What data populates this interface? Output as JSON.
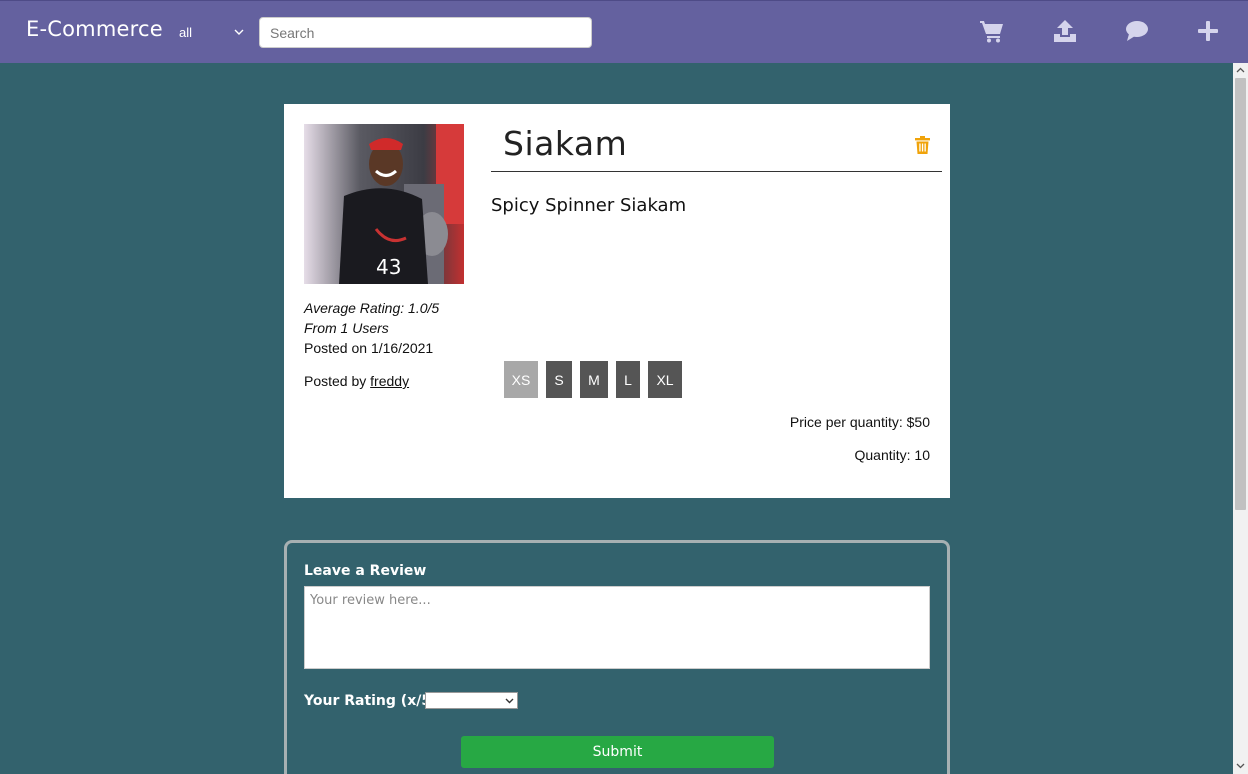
{
  "header": {
    "brand": "E-Commerce",
    "category_selected": "all",
    "search_placeholder": "Search",
    "icons": [
      "cart-icon",
      "upload-icon",
      "chat-icon",
      "plus-icon"
    ]
  },
  "product": {
    "title": "Siakam",
    "description": "Spicy Spinner Siakam",
    "average_rating": "Average Rating: 1.0/5",
    "rating_users": "From 1 Users",
    "posted_on": "Posted on 1/16/2021",
    "posted_by_prefix": "Posted by ",
    "posted_by_user": "freddy",
    "sizes": [
      {
        "label": "XS",
        "available": false
      },
      {
        "label": "S",
        "available": true
      },
      {
        "label": "M",
        "available": true
      },
      {
        "label": "L",
        "available": true
      },
      {
        "label": "XL",
        "available": true
      }
    ],
    "price": "Price per quantity: $50",
    "quantity": "Quantity: 10",
    "jersey_text": "43"
  },
  "review": {
    "title": "Leave a Review",
    "placeholder": "Your review here...",
    "rating_label": "Your Rating (x/5):",
    "rating_value": "",
    "submit_label": "Submit"
  },
  "colors": {
    "header": "#64619f",
    "page_bg": "#33626d",
    "submit": "#27a844",
    "trash": "#f0a30a"
  }
}
